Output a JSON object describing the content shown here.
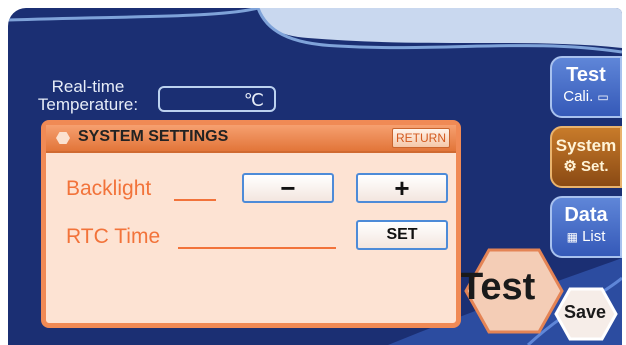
{
  "temperature": {
    "label_line1": "Real-time",
    "label_line2": "Temperature:",
    "value": "",
    "unit": "℃"
  },
  "side_tabs": [
    {
      "title": "Test",
      "subtitle": "Cali.",
      "icon": "monitor-icon",
      "active": false
    },
    {
      "title": "System",
      "subtitle": "Set.",
      "icon": "gear-icon",
      "active": true
    },
    {
      "title": "Data",
      "subtitle": "List",
      "icon": "list-icon",
      "active": false
    }
  ],
  "dialog": {
    "title": "SYSTEM SETTINGS",
    "return_label": "RETURN",
    "backlight_label": "Backlight",
    "minus_label": "−",
    "plus_label": "+",
    "rtc_label": "RTC Time",
    "set_label": "SET"
  },
  "actions": {
    "test_label": "Test",
    "save_label": "Save"
  },
  "colors": {
    "screen_bg": "#1b2f73",
    "dialog_bg": "#fde3d3",
    "dialog_border": "#f08a55",
    "accent_orange": "#f2733a",
    "button_border": "#4d8bd8"
  }
}
